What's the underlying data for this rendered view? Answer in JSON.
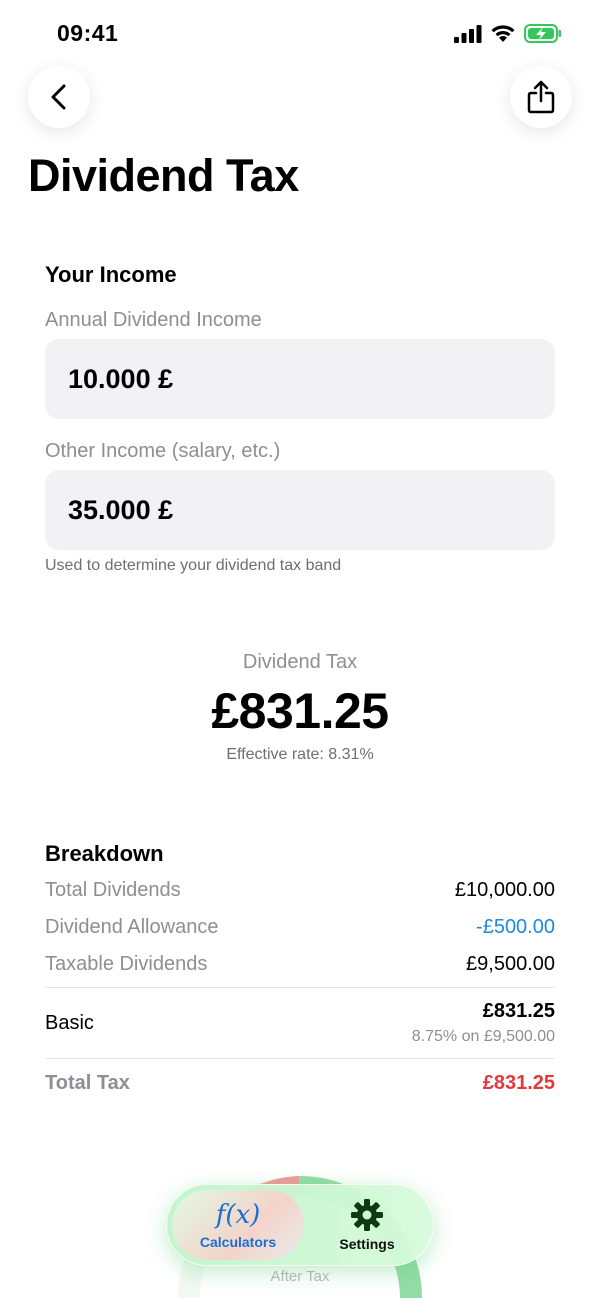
{
  "status": {
    "time": "09:41"
  },
  "page": {
    "title": "Dividend Tax"
  },
  "income": {
    "section_title": "Your Income",
    "dividend_label": "Annual Dividend Income",
    "dividend_value": "10.000 £",
    "other_label": "Other Income (salary, etc.)",
    "other_value": "35.000 £",
    "hint": "Used to determine your dividend tax band"
  },
  "result": {
    "label": "Dividend Tax",
    "value": "£831.25",
    "effective_rate": "Effective rate: 8.31%"
  },
  "breakdown": {
    "title": "Breakdown",
    "rows": [
      {
        "label": "Total Dividends",
        "value": "£10,000.00"
      },
      {
        "label": "Dividend Allowance",
        "value": "-£500.00"
      },
      {
        "label": "Taxable Dividends",
        "value": "£9,500.00"
      }
    ],
    "band": {
      "label": "Basic",
      "value": "£831.25",
      "detail": "8.75% on £9,500.00"
    },
    "total": {
      "label": "Total Tax",
      "value": "£831.25"
    }
  },
  "gauge_peek": {
    "label": "After Tax"
  },
  "tabs": [
    {
      "label": "Calculators",
      "icon": "f(x)"
    },
    {
      "label": "Settings",
      "icon": "gear-icon"
    }
  ],
  "colors": {
    "accent_blue": "#1a6fd4",
    "allowance_blue": "#1e88e5",
    "total_red": "#e5383b",
    "tab_green": "#c8f5cf"
  }
}
